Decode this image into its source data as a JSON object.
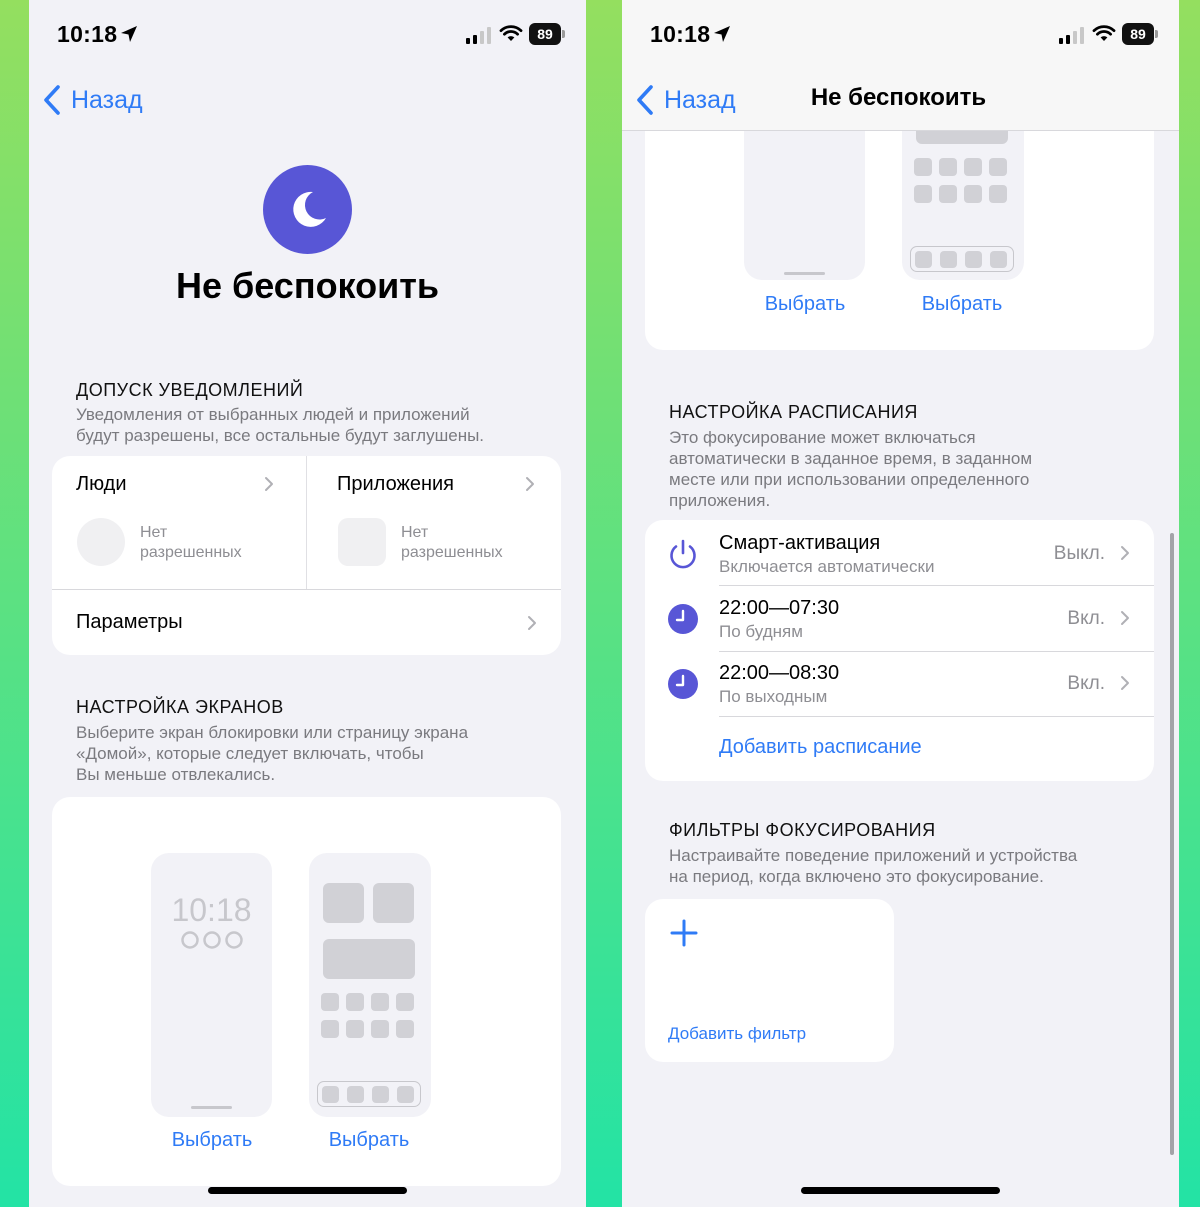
{
  "colors": {
    "accent": "#2f7bf6",
    "focus_purple": "#5856d6",
    "background": "#f2f2f7",
    "secondary_text": "#8e8e93",
    "gradient_top": "#94df5f",
    "gradient_bottom": "#23e3a5"
  },
  "left": {
    "status": {
      "time": "10:18",
      "battery": "89"
    },
    "back_label": "Назад",
    "focus_icon": "moon-icon",
    "title": "Не беспокоить",
    "allowed": {
      "header": "ДОПУСК УВЕДОМЛЕНИЙ",
      "desc_line1": "Уведомления от выбранных людей и приложений",
      "desc_line2": "будут разрешены, все остальные будут заглушены.",
      "people_label": "Люди",
      "people_status_line1": "Нет",
      "people_status_line2": "разрешенных",
      "apps_label": "Приложения",
      "apps_status_line1": "Нет",
      "apps_status_line2": "разрешенных",
      "params_label": "Параметры"
    },
    "screens": {
      "header": "НАСТРОЙКА ЭКРАНОВ",
      "desc_line1": "Выберите экран блокировки или страницу экрана",
      "desc_line2": "«Домой», которые следует включать, чтобы",
      "desc_line3": "Вы меньше отвлекались.",
      "lock_time": "10:18",
      "choose_lock": "Выбрать",
      "choose_home": "Выбрать"
    }
  },
  "right": {
    "status": {
      "time": "10:18",
      "battery": "89"
    },
    "back_label": "Назад",
    "nav_title": "Не беспокоить",
    "screens": {
      "choose_lock": "Выбрать",
      "choose_home": "Выбрать"
    },
    "schedule": {
      "header": "НАСТРОЙКА РАСПИСАНИЯ",
      "desc_line1": "Это фокусирование может включаться",
      "desc_line2": "автоматически в заданное время, в заданном",
      "desc_line3": "месте или при использовании определенного",
      "desc_line4": "приложения.",
      "rows": [
        {
          "icon": "power-icon",
          "title": "Смарт-активация",
          "subtitle": "Включается автоматически",
          "value": "Выкл."
        },
        {
          "icon": "clock-icon",
          "title": "22:00—07:30",
          "subtitle": "По будням",
          "value": "Вкл."
        },
        {
          "icon": "clock-icon",
          "title": "22:00—08:30",
          "subtitle": "По выходным",
          "value": "Вкл."
        }
      ],
      "add_label": "Добавить расписание"
    },
    "filters": {
      "header": "ФИЛЬТРЫ ФОКУСИРОВАНИЯ",
      "desc_line1": "Настраивайте поведение приложений и устройства",
      "desc_line2": "на период, когда включено это фокусирование.",
      "add_label": "Добавить фильтр"
    }
  }
}
